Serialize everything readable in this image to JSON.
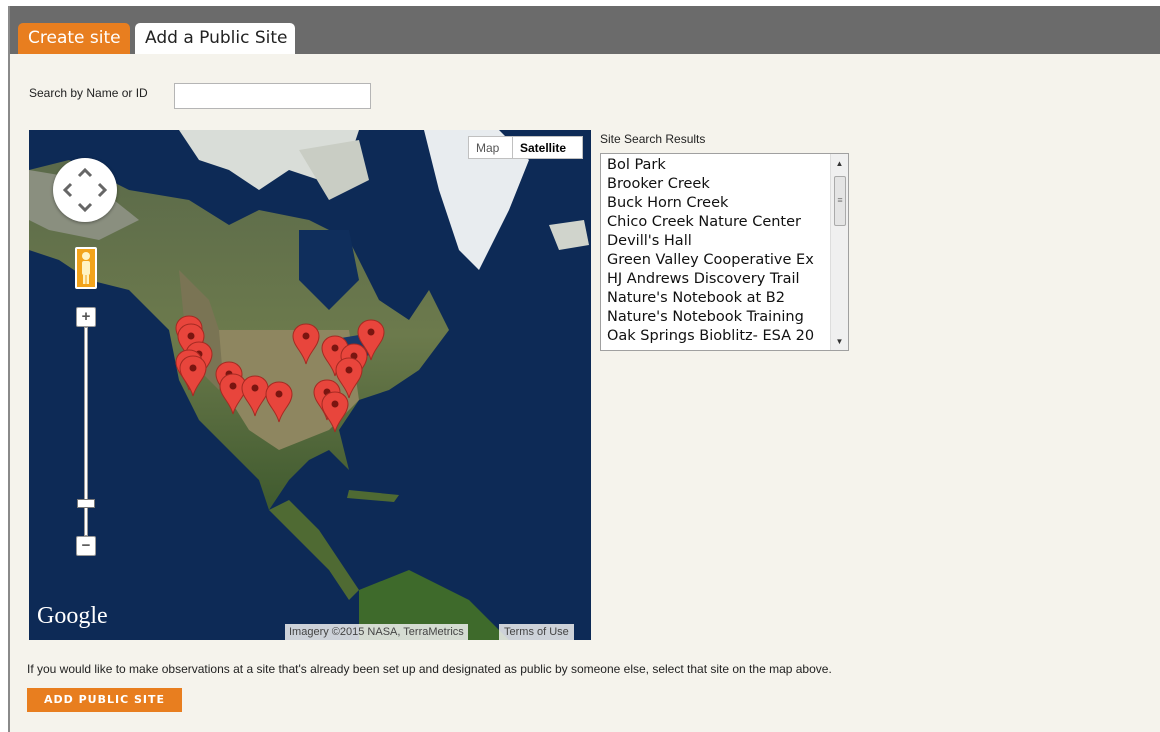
{
  "tabs": [
    {
      "label": "Create site"
    },
    {
      "label": "Add a Public Site"
    }
  ],
  "search": {
    "label": "Search by Name or ID",
    "value": ""
  },
  "map": {
    "type_buttons": {
      "map": "Map",
      "satellite": "Satellite"
    },
    "selected_type": "Satellite",
    "logo": "Google",
    "attribution": "Imagery ©2015 NASA, TerraMetrics",
    "terms": "Terms of Use",
    "marker_color": "#e8453c"
  },
  "results": {
    "label": "Site Search Results",
    "items": [
      "Bol Park",
      "Brooker Creek",
      "Buck Horn Creek",
      "Chico Creek Nature Center",
      "Devill's Hall",
      "Green Valley Cooperative Ex",
      "HJ Andrews Discovery Trail",
      "Nature's Notebook at B2",
      "Nature's Notebook Training",
      "Oak Springs Bioblitz- ESA 20"
    ]
  },
  "footer": {
    "info": "If you would like to make observations at a site that's already been set up and designated as public by someone else, select that site on the map above.",
    "button": "ADD PUBLIC SITE"
  },
  "colors": {
    "accent": "#e87e1f",
    "tab_bar": "#6b6b6b",
    "background": "#f5f3ec"
  }
}
